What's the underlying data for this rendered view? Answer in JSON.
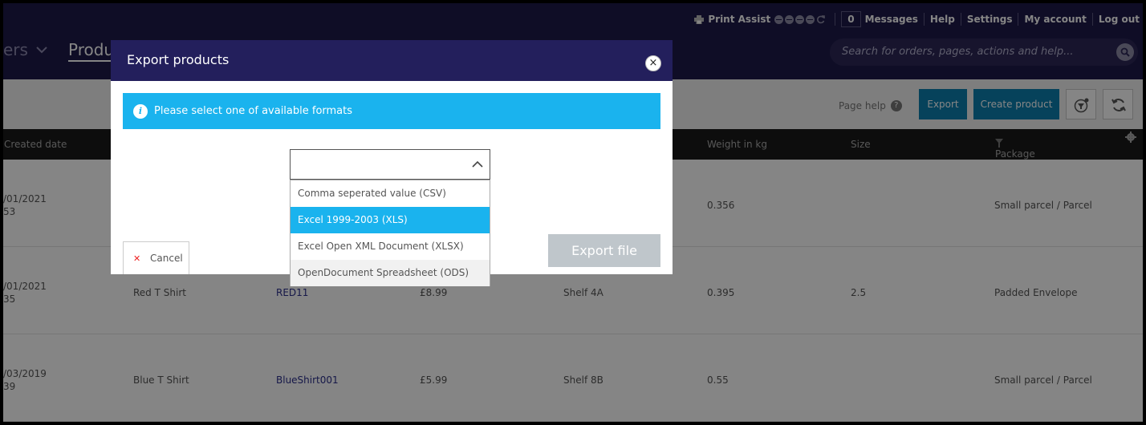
{
  "header": {
    "print_assist": "Print Assist",
    "messages_count": "0",
    "messages": "Messages",
    "help": "Help",
    "settings": "Settings",
    "my_account": "My account",
    "log_out": "Log out",
    "nav_orders_partial": "ers",
    "nav_products_partial": "Produ",
    "search_placeholder": "Search for orders, pages, actions and help..."
  },
  "toolbar": {
    "page_help": "Page help",
    "export": "Export",
    "create_product": "Create product"
  },
  "table": {
    "columns": {
      "created_date": "Created date",
      "weight": "Weight in kg",
      "size": "Size",
      "package_format": "Package format"
    },
    "rows": [
      {
        "date": "/01/2021",
        "time": "53",
        "name": "",
        "sku": "",
        "price": "",
        "location": "",
        "weight": "0.356",
        "size": "",
        "package": "Small parcel / Parcel"
      },
      {
        "date": "/01/2021",
        "time": "35",
        "name": "Red T Shirt",
        "sku": "RED11",
        "price": "£8.99",
        "location": "Shelf 4A",
        "weight": "0.395",
        "size": "2.5",
        "package": "Padded Envelope"
      },
      {
        "date": "/03/2019",
        "time": "39",
        "name": "Blue T Shirt",
        "sku": "BlueShirt001",
        "price": "£5.99",
        "location": "Shelf 8B",
        "weight": "0.55",
        "size": "",
        "package": "Small parcel / Parcel"
      }
    ]
  },
  "modal": {
    "title": "Export products",
    "close": "×",
    "info_message": "Please select one of available formats",
    "selected_value": "",
    "options": [
      "Comma seperated value (CSV)",
      "Excel 1999-2003 (XLS)",
      "Excel Open XML Document (XLSX)",
      "OpenDocument Spreadsheet (ODS)"
    ],
    "highlighted_option_index": 1,
    "cancel": "Cancel",
    "export_file": "Export file"
  },
  "colors": {
    "header_navy": "#1e1a49",
    "modal_header": "#231f5c",
    "info_blue": "#1ab3ee",
    "button_blue": "#0d7fae",
    "disabled_grey": "#bfc6cb"
  }
}
